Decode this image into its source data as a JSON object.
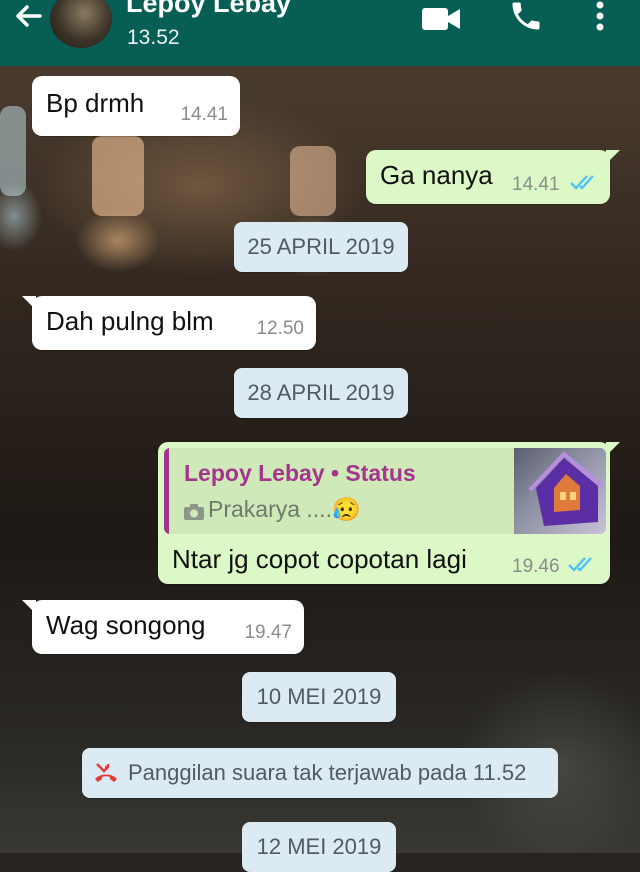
{
  "header": {
    "contact_name": "Lepoy Lebay",
    "last_seen": "13.52",
    "icons": [
      "back-arrow-icon",
      "video-call-icon",
      "phone-icon",
      "more-vert-icon"
    ]
  },
  "messages": [
    {
      "dir": "in",
      "text": "Bp drmh",
      "time": "14.41"
    },
    {
      "dir": "out",
      "text": "Ga nanya",
      "time": "14.41",
      "status": "read"
    },
    {
      "type": "date",
      "text": "25 APRIL 2019"
    },
    {
      "dir": "in",
      "text": "Dah pulng blm",
      "time": "12.50"
    },
    {
      "type": "date",
      "text": "28 APRIL 2019"
    },
    {
      "dir": "out",
      "quote": {
        "author": "Lepoy Lebay • Status",
        "text": "Prakarya ....😥"
      },
      "text": "Ntar jg copot copotan lagi",
      "time": "19.46",
      "status": "read"
    },
    {
      "dir": "in",
      "text": "Wag songong",
      "time": "19.47"
    },
    {
      "type": "date",
      "text": "10 MEI 2019"
    },
    {
      "type": "system",
      "text": "Panggilan suara tak terjawab pada 11.52"
    },
    {
      "type": "date",
      "text": "12 MEI 2019"
    }
  ],
  "colors": {
    "header": "#075e54",
    "bubble_out": "#dcf8c6",
    "bubble_in": "#ffffff",
    "date_chip": "#dcebf3",
    "read_ticks": "#4fc3f7",
    "quote_accent": "#a4358f",
    "missed_call": "#e53935"
  }
}
